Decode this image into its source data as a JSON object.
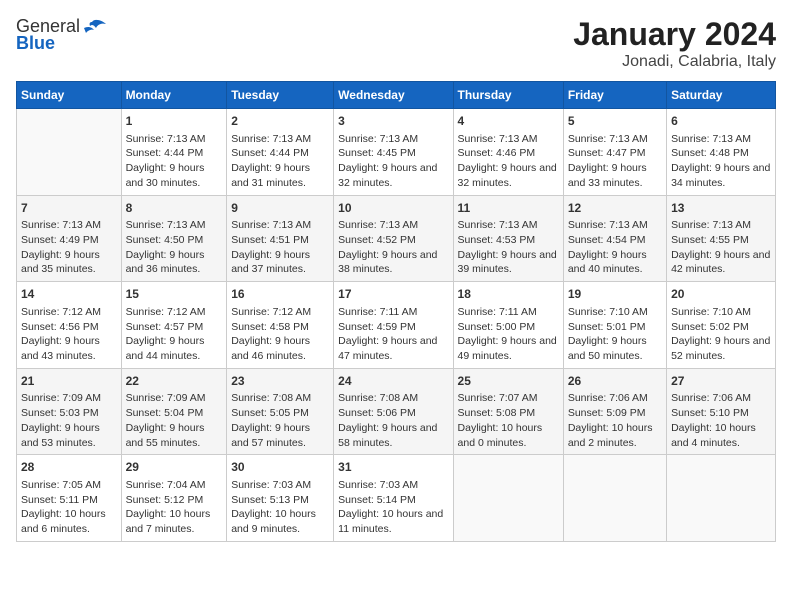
{
  "header": {
    "logo": {
      "general": "General",
      "blue": "Blue"
    },
    "title": "January 2024",
    "subtitle": "Jonadi, Calabria, Italy"
  },
  "weekdays": [
    "Sunday",
    "Monday",
    "Tuesday",
    "Wednesday",
    "Thursday",
    "Friday",
    "Saturday"
  ],
  "weeks": [
    [
      {
        "day": "",
        "sunrise": "",
        "sunset": "",
        "daylight": ""
      },
      {
        "day": "1",
        "sunrise": "Sunrise: 7:13 AM",
        "sunset": "Sunset: 4:44 PM",
        "daylight": "Daylight: 9 hours and 30 minutes."
      },
      {
        "day": "2",
        "sunrise": "Sunrise: 7:13 AM",
        "sunset": "Sunset: 4:44 PM",
        "daylight": "Daylight: 9 hours and 31 minutes."
      },
      {
        "day": "3",
        "sunrise": "Sunrise: 7:13 AM",
        "sunset": "Sunset: 4:45 PM",
        "daylight": "Daylight: 9 hours and 32 minutes."
      },
      {
        "day": "4",
        "sunrise": "Sunrise: 7:13 AM",
        "sunset": "Sunset: 4:46 PM",
        "daylight": "Daylight: 9 hours and 32 minutes."
      },
      {
        "day": "5",
        "sunrise": "Sunrise: 7:13 AM",
        "sunset": "Sunset: 4:47 PM",
        "daylight": "Daylight: 9 hours and 33 minutes."
      },
      {
        "day": "6",
        "sunrise": "Sunrise: 7:13 AM",
        "sunset": "Sunset: 4:48 PM",
        "daylight": "Daylight: 9 hours and 34 minutes."
      }
    ],
    [
      {
        "day": "7",
        "sunrise": "Sunrise: 7:13 AM",
        "sunset": "Sunset: 4:49 PM",
        "daylight": "Daylight: 9 hours and 35 minutes."
      },
      {
        "day": "8",
        "sunrise": "Sunrise: 7:13 AM",
        "sunset": "Sunset: 4:50 PM",
        "daylight": "Daylight: 9 hours and 36 minutes."
      },
      {
        "day": "9",
        "sunrise": "Sunrise: 7:13 AM",
        "sunset": "Sunset: 4:51 PM",
        "daylight": "Daylight: 9 hours and 37 minutes."
      },
      {
        "day": "10",
        "sunrise": "Sunrise: 7:13 AM",
        "sunset": "Sunset: 4:52 PM",
        "daylight": "Daylight: 9 hours and 38 minutes."
      },
      {
        "day": "11",
        "sunrise": "Sunrise: 7:13 AM",
        "sunset": "Sunset: 4:53 PM",
        "daylight": "Daylight: 9 hours and 39 minutes."
      },
      {
        "day": "12",
        "sunrise": "Sunrise: 7:13 AM",
        "sunset": "Sunset: 4:54 PM",
        "daylight": "Daylight: 9 hours and 40 minutes."
      },
      {
        "day": "13",
        "sunrise": "Sunrise: 7:13 AM",
        "sunset": "Sunset: 4:55 PM",
        "daylight": "Daylight: 9 hours and 42 minutes."
      }
    ],
    [
      {
        "day": "14",
        "sunrise": "Sunrise: 7:12 AM",
        "sunset": "Sunset: 4:56 PM",
        "daylight": "Daylight: 9 hours and 43 minutes."
      },
      {
        "day": "15",
        "sunrise": "Sunrise: 7:12 AM",
        "sunset": "Sunset: 4:57 PM",
        "daylight": "Daylight: 9 hours and 44 minutes."
      },
      {
        "day": "16",
        "sunrise": "Sunrise: 7:12 AM",
        "sunset": "Sunset: 4:58 PM",
        "daylight": "Daylight: 9 hours and 46 minutes."
      },
      {
        "day": "17",
        "sunrise": "Sunrise: 7:11 AM",
        "sunset": "Sunset: 4:59 PM",
        "daylight": "Daylight: 9 hours and 47 minutes."
      },
      {
        "day": "18",
        "sunrise": "Sunrise: 7:11 AM",
        "sunset": "Sunset: 5:00 PM",
        "daylight": "Daylight: 9 hours and 49 minutes."
      },
      {
        "day": "19",
        "sunrise": "Sunrise: 7:10 AM",
        "sunset": "Sunset: 5:01 PM",
        "daylight": "Daylight: 9 hours and 50 minutes."
      },
      {
        "day": "20",
        "sunrise": "Sunrise: 7:10 AM",
        "sunset": "Sunset: 5:02 PM",
        "daylight": "Daylight: 9 hours and 52 minutes."
      }
    ],
    [
      {
        "day": "21",
        "sunrise": "Sunrise: 7:09 AM",
        "sunset": "Sunset: 5:03 PM",
        "daylight": "Daylight: 9 hours and 53 minutes."
      },
      {
        "day": "22",
        "sunrise": "Sunrise: 7:09 AM",
        "sunset": "Sunset: 5:04 PM",
        "daylight": "Daylight: 9 hours and 55 minutes."
      },
      {
        "day": "23",
        "sunrise": "Sunrise: 7:08 AM",
        "sunset": "Sunset: 5:05 PM",
        "daylight": "Daylight: 9 hours and 57 minutes."
      },
      {
        "day": "24",
        "sunrise": "Sunrise: 7:08 AM",
        "sunset": "Sunset: 5:06 PM",
        "daylight": "Daylight: 9 hours and 58 minutes."
      },
      {
        "day": "25",
        "sunrise": "Sunrise: 7:07 AM",
        "sunset": "Sunset: 5:08 PM",
        "daylight": "Daylight: 10 hours and 0 minutes."
      },
      {
        "day": "26",
        "sunrise": "Sunrise: 7:06 AM",
        "sunset": "Sunset: 5:09 PM",
        "daylight": "Daylight: 10 hours and 2 minutes."
      },
      {
        "day": "27",
        "sunrise": "Sunrise: 7:06 AM",
        "sunset": "Sunset: 5:10 PM",
        "daylight": "Daylight: 10 hours and 4 minutes."
      }
    ],
    [
      {
        "day": "28",
        "sunrise": "Sunrise: 7:05 AM",
        "sunset": "Sunset: 5:11 PM",
        "daylight": "Daylight: 10 hours and 6 minutes."
      },
      {
        "day": "29",
        "sunrise": "Sunrise: 7:04 AM",
        "sunset": "Sunset: 5:12 PM",
        "daylight": "Daylight: 10 hours and 7 minutes."
      },
      {
        "day": "30",
        "sunrise": "Sunrise: 7:03 AM",
        "sunset": "Sunset: 5:13 PM",
        "daylight": "Daylight: 10 hours and 9 minutes."
      },
      {
        "day": "31",
        "sunrise": "Sunrise: 7:03 AM",
        "sunset": "Sunset: 5:14 PM",
        "daylight": "Daylight: 10 hours and 11 minutes."
      },
      {
        "day": "",
        "sunrise": "",
        "sunset": "",
        "daylight": ""
      },
      {
        "day": "",
        "sunrise": "",
        "sunset": "",
        "daylight": ""
      },
      {
        "day": "",
        "sunrise": "",
        "sunset": "",
        "daylight": ""
      }
    ]
  ]
}
